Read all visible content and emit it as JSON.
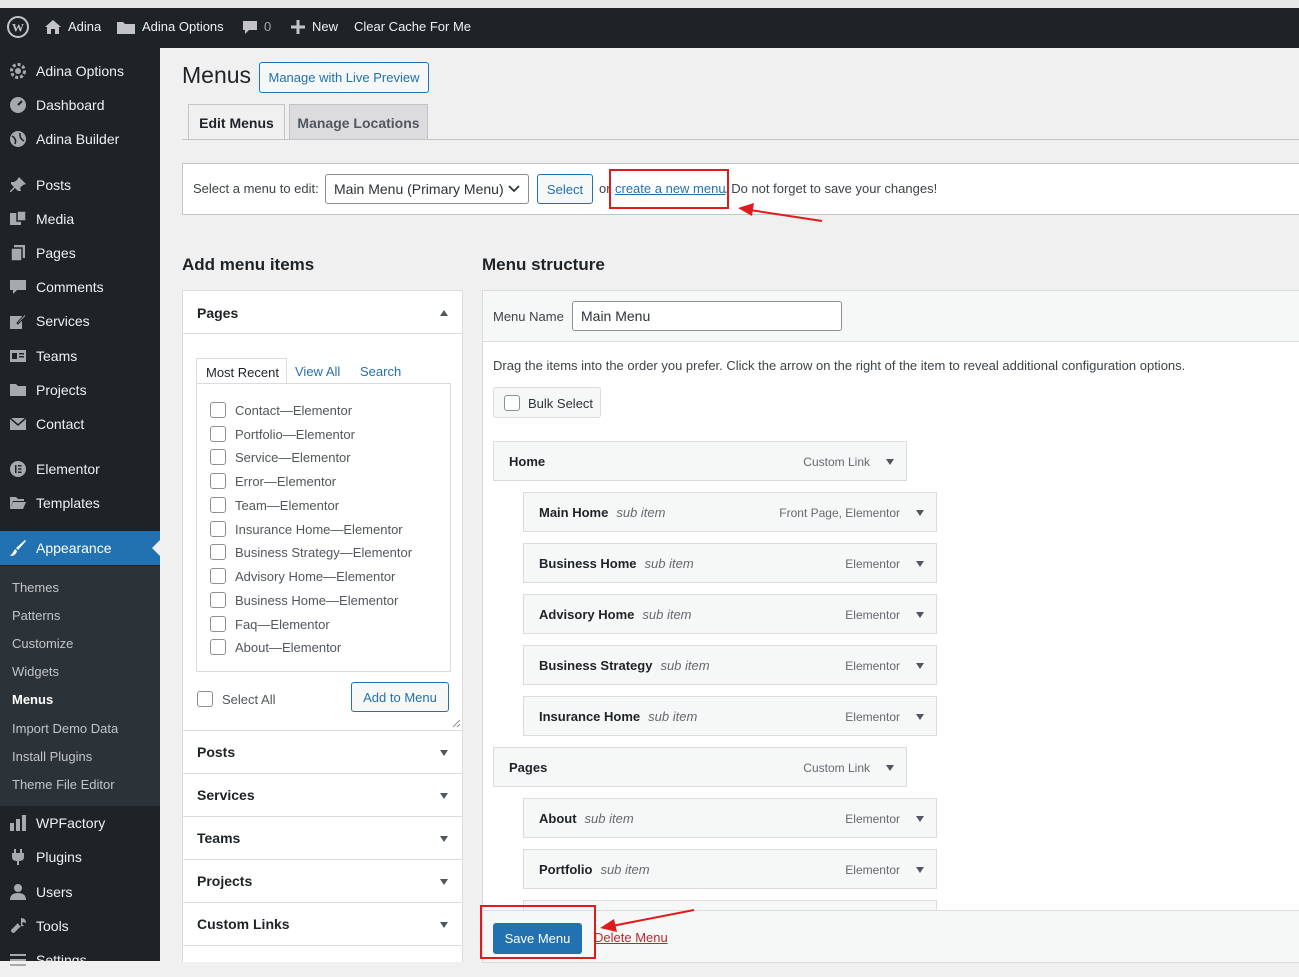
{
  "adminbar": {
    "site": "Adina",
    "options": "Adina Options",
    "comments": "0",
    "new": "New",
    "cache": "Clear Cache For Me"
  },
  "sidebar": {
    "items": [
      {
        "label": "Adina Options",
        "icon": "gear-icon"
      },
      {
        "label": "Dashboard",
        "icon": "dashboard-icon"
      },
      {
        "label": "Adina Builder",
        "icon": "globe-icon"
      },
      {
        "label": "Posts",
        "icon": "pin-icon"
      },
      {
        "label": "Media",
        "icon": "media-icon"
      },
      {
        "label": "Pages",
        "icon": "pages-icon"
      },
      {
        "label": "Comments",
        "icon": "comment-icon"
      },
      {
        "label": "Services",
        "icon": "edit-icon"
      },
      {
        "label": "Teams",
        "icon": "id-card-icon"
      },
      {
        "label": "Projects",
        "icon": "folder-icon"
      },
      {
        "label": "Contact",
        "icon": "email-icon"
      },
      {
        "label": "Elementor",
        "icon": "elementor-icon"
      },
      {
        "label": "Templates",
        "icon": "folder-open-icon"
      },
      {
        "label": "Appearance",
        "icon": "paintbrush-icon"
      },
      {
        "label": "WPFactory",
        "icon": "chart-icon"
      },
      {
        "label": "Plugins",
        "icon": "plugin-icon"
      },
      {
        "label": "Users",
        "icon": "user-icon"
      },
      {
        "label": "Tools",
        "icon": "wrench-icon"
      },
      {
        "label": "Settings",
        "icon": "settings-icon"
      }
    ],
    "submenu": [
      "Themes",
      "Patterns",
      "Customize",
      "Widgets",
      "Menus",
      "Import Demo Data",
      "Install Plugins",
      "Theme File Editor"
    ]
  },
  "page": {
    "title": "Menus",
    "live_preview": "Manage with Live Preview",
    "tabs": [
      "Edit Menus",
      "Manage Locations"
    ],
    "select_label": "Select a menu to edit:",
    "select_value": "Main Menu (Primary Menu)",
    "select_btn": "Select",
    "or": "or",
    "create_link": "create a new menu",
    "save_note": ". Do not forget to save your changes!"
  },
  "add_items": {
    "heading": "Add menu items",
    "pages_title": "Pages",
    "inner_tabs": [
      "Most Recent",
      "View All",
      "Search"
    ],
    "pages": [
      {
        "name": "Contact",
        "tag": "Elementor"
      },
      {
        "name": "Portfolio",
        "tag": "Elementor"
      },
      {
        "name": "Service",
        "tag": "Elementor"
      },
      {
        "name": "Error",
        "tag": "Elementor"
      },
      {
        "name": "Team",
        "tag": "Elementor"
      },
      {
        "name": "Insurance Home",
        "tag": "Elementor"
      },
      {
        "name": "Business Strategy",
        "tag": "Elementor"
      },
      {
        "name": "Advisory Home",
        "tag": "Elementor"
      },
      {
        "name": "Business Home",
        "tag": "Elementor"
      },
      {
        "name": "Faq",
        "tag": "Elementor"
      },
      {
        "name": "About",
        "tag": "Elementor"
      }
    ],
    "dash": " — ",
    "select_all": "Select All",
    "add_btn": "Add to Menu",
    "sections": [
      "Posts",
      "Services",
      "Teams",
      "Projects",
      "Custom Links"
    ]
  },
  "structure": {
    "heading": "Menu structure",
    "name_label": "Menu Name",
    "name_value": "Main Menu",
    "instructions": "Drag the items into the order you prefer. Click the arrow on the right of the item to reveal additional configuration options.",
    "bulk": "Bulk Select",
    "sub_label": "sub item",
    "items": [
      {
        "title": "Home",
        "type": "Custom Link",
        "depth": 0
      },
      {
        "title": "Main Home",
        "type": "Front Page, Elementor",
        "depth": 1
      },
      {
        "title": "Business Home",
        "type": "Elementor",
        "depth": 1
      },
      {
        "title": "Advisory Home",
        "type": "Elementor",
        "depth": 1
      },
      {
        "title": "Business Strategy",
        "type": "Elementor",
        "depth": 1
      },
      {
        "title": "Insurance Home",
        "type": "Elementor",
        "depth": 1
      },
      {
        "title": "Pages",
        "type": "Custom Link",
        "depth": 0
      },
      {
        "title": "About",
        "type": "Elementor",
        "depth": 1
      },
      {
        "title": "Portfolio",
        "type": "Elementor",
        "depth": 1
      }
    ],
    "save_btn": "Save Menu",
    "delete_link": "Delete Menu"
  },
  "colors": {
    "accent": "#2271b1",
    "annotation": "#e01b1b",
    "admin_bg": "#1d2327"
  }
}
